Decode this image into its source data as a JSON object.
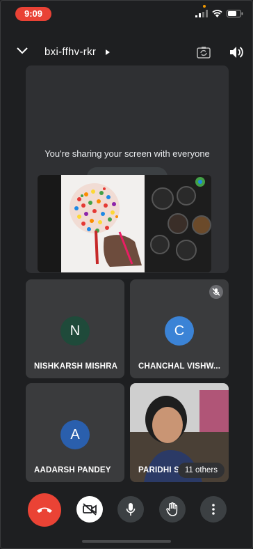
{
  "status_bar": {
    "time": "9:09"
  },
  "header": {
    "meeting_code": "bxi-ffhv-rkr"
  },
  "share": {
    "message": "You're sharing your screen with everyone"
  },
  "tiles": [
    {
      "initial": "N",
      "name": "NISHKARSH MISHRA",
      "avatar_color": "#1f4a3a"
    },
    {
      "initial": "C",
      "name": "CHANCHAL VISHW...",
      "avatar_color": "#3b83d6"
    },
    {
      "initial": "A",
      "name": "AADARSH PANDEY",
      "avatar_color": "#2a5fad"
    },
    {
      "name": "PARIDHI SI",
      "others": "11 others"
    }
  ],
  "colors": {
    "accent_red": "#ea4335",
    "tile_bg": "#3a3b3d",
    "bg": "#1e1f21"
  },
  "icons": [
    "chevron-down-icon",
    "triangle-right-icon",
    "camera-flip-icon",
    "speaker-icon",
    "mic-off-icon",
    "end-call-icon",
    "camera-off-icon",
    "mic-icon",
    "raise-hand-icon",
    "more-vert-icon"
  ]
}
